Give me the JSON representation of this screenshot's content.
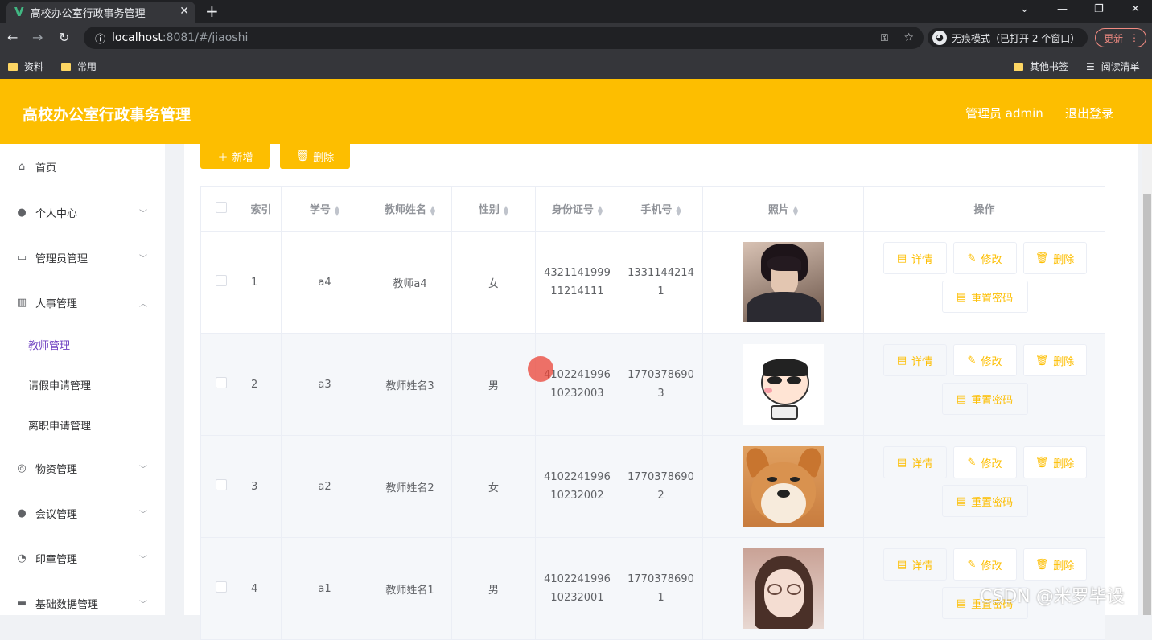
{
  "browser": {
    "tab_title": "高校办公室行政事务管理",
    "url_host": "localhost",
    "url_path": ":8081/#/jiaoshi",
    "incognito_label": "无痕模式（已打开 2 个窗口）",
    "update_label": "更新",
    "bookmarks": [
      "资料",
      "常用"
    ],
    "other_bookmarks": "其他书签",
    "reading_list": "阅读清单"
  },
  "header": {
    "title": "高校办公室行政事务管理",
    "admin": "管理员 admin",
    "logout": "退出登录"
  },
  "sidebar": {
    "items": [
      {
        "label": "首页",
        "icon": "home-icon"
      },
      {
        "label": "个人中心",
        "icon": "user-icon"
      },
      {
        "label": "管理员管理",
        "icon": "id-card-icon"
      },
      {
        "label": "人事管理",
        "icon": "library-icon"
      },
      {
        "label": "物资管理",
        "icon": "compass-icon"
      },
      {
        "label": "会议管理",
        "icon": "bulb-icon"
      },
      {
        "label": "印章管理",
        "icon": "gauge-icon"
      },
      {
        "label": "基础数据管理",
        "icon": "data-icon"
      }
    ],
    "subitems": [
      "教师管理",
      "请假申请管理",
      "离职申请管理"
    ]
  },
  "toolbar": {
    "add": "新增",
    "delete": "删除"
  },
  "table": {
    "headers": [
      "索引",
      "学号",
      "教师姓名",
      "性别",
      "身份证号",
      "手机号",
      "照片",
      "操作"
    ],
    "rows": [
      {
        "index": "1",
        "no": "a4",
        "name": "教师a4",
        "gender": "女",
        "id_line1": "4321141999",
        "id_line2": "11214111",
        "phone_line1": "1331144214",
        "phone_line2": "1",
        "photo": "dark-hair-portrait"
      },
      {
        "index": "2",
        "no": "a3",
        "name": "教师姓名3",
        "gender": "男",
        "id_line1": "4102241996",
        "id_line2": "10232003",
        "phone_line1": "1770378690",
        "phone_line2": "3",
        "photo": "cartoon-boy"
      },
      {
        "index": "3",
        "no": "a2",
        "name": "教师姓名2",
        "gender": "女",
        "id_line1": "4102241996",
        "id_line2": "10232002",
        "phone_line1": "1770378690",
        "phone_line2": "2",
        "photo": "shiba-dog"
      },
      {
        "index": "4",
        "no": "a1",
        "name": "教师姓名1",
        "gender": "男",
        "id_line1": "4102241996",
        "id_line2": "10232001",
        "phone_line1": "1770378690",
        "phone_line2": "1",
        "photo": "girl-glasses"
      }
    ],
    "actions": {
      "detail": "详情",
      "edit": "修改",
      "delete": "删除",
      "reset": "重置密码"
    }
  },
  "watermark": "CSDN @米罗毕设",
  "colors": {
    "accent": "#fdbe00",
    "active_menu": "#6f42c1"
  }
}
